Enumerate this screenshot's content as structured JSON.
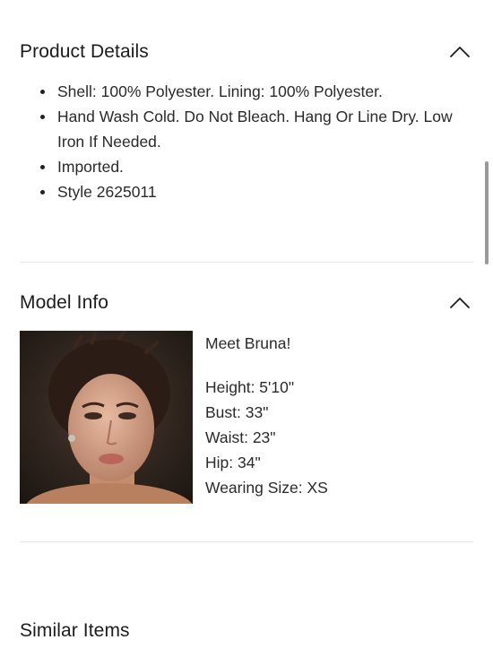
{
  "product_details": {
    "title": "Product Details",
    "items": [
      "Shell: 100% Polyester. Lining: 100% Polyester.",
      "Hand Wash Cold. Do Not Bleach. Hang Or Line Dry. Low Iron If Needed.",
      "Imported.",
      "Style 2625011"
    ]
  },
  "model_info": {
    "title": "Model Info",
    "greeting": "Meet Bruna!",
    "stats": [
      "Height: 5'10\"",
      "Bust: 33\"",
      "Waist: 23\"",
      "Hip: 34\"",
      "Wearing Size: XS"
    ]
  },
  "similar_items": {
    "title": "Similar Items"
  },
  "icons": {
    "collapse": "chevron-up-icon"
  }
}
